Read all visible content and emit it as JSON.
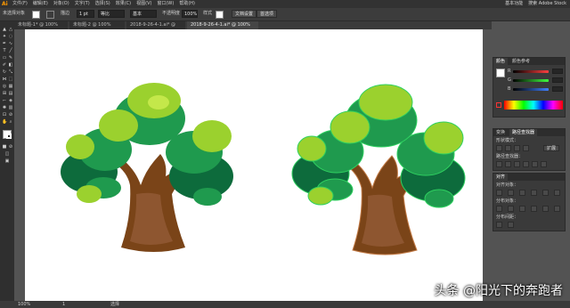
{
  "app": {
    "logo": "Ai",
    "menus": [
      "文件(F)",
      "编辑(E)",
      "对象(O)",
      "文字(T)",
      "选择(S)",
      "效果(C)",
      "视图(V)",
      "窗口(W)",
      "帮助(H)"
    ],
    "workspace": "基本功能",
    "search_placeholder": "搜索 Adobe Stock"
  },
  "control_bar": {
    "selection_label": "未选择对象",
    "stroke_label": "描边",
    "stroke_value": "1 pt",
    "brush_label": "等比",
    "brush_value": "基本",
    "opacity_label": "不透明度",
    "opacity_value": "100%",
    "style_label": "样式",
    "doc_setup_button": "文档设置",
    "preferences_button": "首选项"
  },
  "tabs": [
    {
      "label": "未标题-1* @ 100% (RGB/GPU 预览)",
      "active": false
    },
    {
      "label": "未标题-2 @ 100% (CMYK/GPU 预览)",
      "active": false
    },
    {
      "label": "2018-9-26-4-1.ai* @ 100% (RGB/GPU 预览)",
      "active": false
    },
    {
      "label": "2018-9-26-4-1.ai* @ 100% (RGB/GPU 预览)",
      "active": true
    }
  ],
  "status_bar": {
    "zoom": "100%",
    "page": "1",
    "tool": "选择"
  },
  "color_panel": {
    "tabs": [
      "颜色",
      "颜色参考"
    ],
    "channels": [
      "R",
      "G",
      "B"
    ],
    "channel_colors": [
      "#ff4040",
      "#40ff40",
      "#4080ff"
    ]
  },
  "pathfinder_panel": {
    "tabs": [
      "变换",
      "路径查找器"
    ],
    "shape_modes_label": "形状模式：",
    "pathfinders_label": "路径查找器：",
    "expand_button": "扩展"
  },
  "align_panel": {
    "tabs": [
      "对齐"
    ],
    "align_objects_label": "对齐对象：",
    "distribute_objects_label": "分布对象：",
    "distribute_spacing_label": "分布间距："
  },
  "watermark": "头条 @阳光下的奔跑者",
  "colors": {
    "trunk": "#7a4418",
    "trunk_light": "#8e5630",
    "leaf_dark": "#0d6b3c",
    "leaf_mid": "#1f9a4e",
    "leaf_light": "#9bd12e",
    "leaf_highlight": "#c4e84a"
  }
}
